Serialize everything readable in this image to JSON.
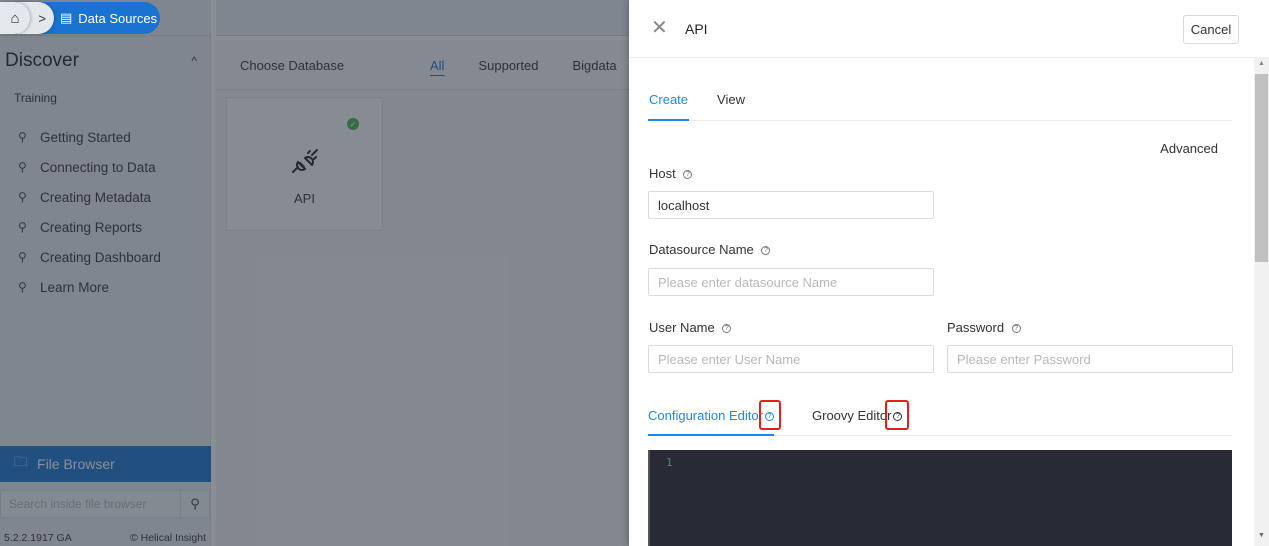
{
  "breadcrumb": {
    "home_icon": "home-icon",
    "separator_icon": "chevron-right-icon",
    "current": "Data Sources",
    "current_icon": "database-icon"
  },
  "sidebar": {
    "section_title": "Discover",
    "section_toggle_icon": "chevron-up-icon",
    "group_label": "Training",
    "items": [
      {
        "label": "Getting Started",
        "icon": "lightbulb-icon"
      },
      {
        "label": "Connecting to Data",
        "icon": "lightbulb-icon"
      },
      {
        "label": "Creating Metadata",
        "icon": "lightbulb-icon"
      },
      {
        "label": "Creating Reports",
        "icon": "lightbulb-icon"
      },
      {
        "label": "Creating Dashboard",
        "icon": "lightbulb-icon"
      },
      {
        "label": "Learn More",
        "icon": "lightbulb-icon"
      }
    ],
    "file_browser": {
      "label": "File Browser",
      "icon": "folder-icon"
    },
    "search": {
      "placeholder": "Search inside file browser",
      "value": "",
      "icon": "search-icon"
    },
    "version": "5.2.2.1917 GA",
    "brand": "© Helical Insight"
  },
  "main": {
    "title": "Choose Database",
    "filters": [
      {
        "label": "All",
        "active": true
      },
      {
        "label": "Supported",
        "active": false
      },
      {
        "label": "Bigdata",
        "active": false
      }
    ],
    "cards": [
      {
        "name": "API",
        "icon": "plug-icon",
        "status": "connected",
        "status_icon": "check-circle-icon"
      }
    ]
  },
  "drawer": {
    "title": "API",
    "close_icon": "close-icon",
    "cancel_label": "Cancel",
    "mode_tabs": [
      {
        "label": "Create",
        "active": true
      },
      {
        "label": "View",
        "active": false
      }
    ],
    "advanced_label": "Advanced",
    "fields": {
      "host": {
        "label": "Host",
        "value": "localhost",
        "placeholder": ""
      },
      "datasource_name": {
        "label": "Datasource Name",
        "value": "",
        "placeholder": "Please enter datasource Name"
      },
      "user_name": {
        "label": "User Name",
        "value": "",
        "placeholder": "Please enter User Name"
      },
      "password": {
        "label": "Password",
        "value": "",
        "placeholder": "Please enter Password"
      }
    },
    "help_icon": "question-circle-icon",
    "editor_tabs": [
      {
        "label": "Configuration Editor",
        "active": true
      },
      {
        "label": "Groovy Editor",
        "active": false
      }
    ],
    "editor": {
      "line_numbers": [
        "1"
      ],
      "content": ""
    }
  },
  "colors": {
    "accent": "#1e88e5",
    "primary_nav": "#1a73d0",
    "highlight": "#e02020",
    "editor_bg": "#282b36",
    "success": "#4caf50"
  }
}
